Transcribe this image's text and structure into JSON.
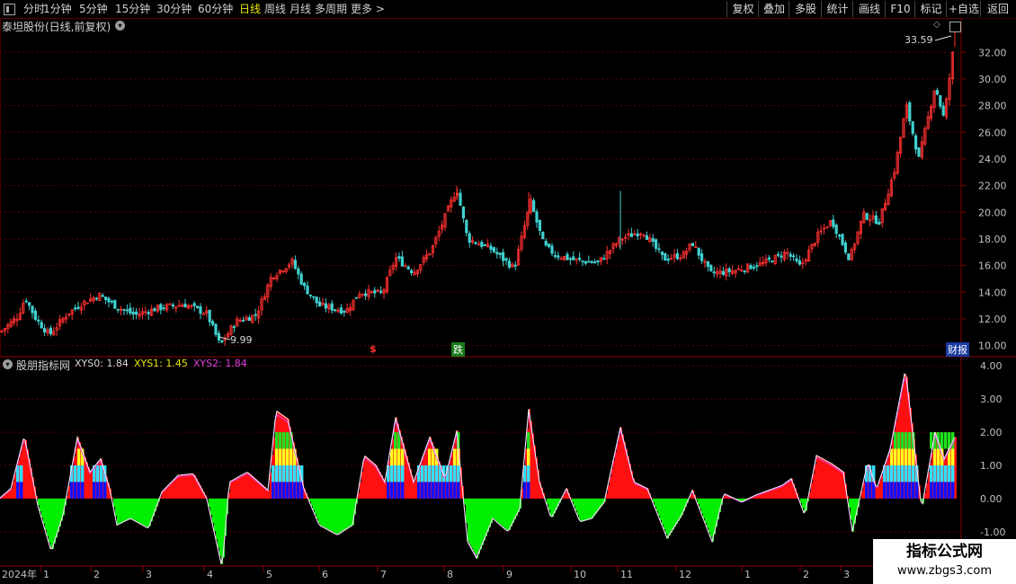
{
  "toolbar": {
    "periods": [
      "分时",
      "1分钟",
      "5分钟",
      "15分钟",
      "30分钟",
      "60分钟",
      "日线",
      "周线",
      "月线",
      "多周期",
      "更多 >"
    ],
    "active_period": "日线",
    "buttons": [
      "复权",
      "叠加",
      "多股",
      "统计",
      "画线",
      "F10",
      "标记",
      "+自选",
      "返回"
    ]
  },
  "main_chart": {
    "title": "泰坦股份(日线,前复权)",
    "high_label": "33.59",
    "low_label": "9.99",
    "event_markers": [
      "$",
      "跌",
      "财报"
    ],
    "y_ticks": [
      "32.00",
      "30.00",
      "28.00",
      "26.00",
      "24.00",
      "22.00",
      "20.00",
      "18.00",
      "16.00",
      "14.00",
      "12.00",
      "10.00"
    ]
  },
  "indicator": {
    "name": "股朋指标网",
    "labels": [
      {
        "name": "XYS0",
        "value": "1.84",
        "color": "#d8d8d8"
      },
      {
        "name": "XYS1",
        "value": "1.45",
        "color": "#e8e800"
      },
      {
        "name": "XYS2",
        "value": "1.84",
        "color": "#e040e0"
      }
    ],
    "y_ticks": [
      "4.00",
      "3.00",
      "2.00",
      "1.00",
      "0.00",
      "-1.00"
    ]
  },
  "time_axis": {
    "year_label": "2024年",
    "months": [
      "1",
      "2",
      "3",
      "4",
      "5",
      "6",
      "7",
      "8",
      "9",
      "10",
      "11",
      "12",
      "1",
      "2",
      "3"
    ]
  },
  "watermark": {
    "line1": "指标公式网",
    "line2": "www.zbgs3.com"
  },
  "colors": {
    "up": "#ff3030",
    "down": "#40d0d0",
    "grid": "#5a0000",
    "frame": "#8a0000",
    "axis_text": "#c0c0c0"
  },
  "chart_data": {
    "type": "candlestick",
    "price_path": [
      [
        0,
        11.0
      ],
      [
        20,
        12.2
      ],
      [
        28,
        13.6
      ],
      [
        40,
        12.0
      ],
      [
        55,
        10.8
      ],
      [
        75,
        12.4
      ],
      [
        92,
        13.2
      ],
      [
        110,
        13.8
      ],
      [
        130,
        12.9
      ],
      [
        150,
        12.3
      ],
      [
        175,
        12.8
      ],
      [
        205,
        13.1
      ],
      [
        230,
        12.4
      ],
      [
        245,
        10.0
      ],
      [
        262,
        11.8
      ],
      [
        285,
        12.3
      ],
      [
        302,
        15.2
      ],
      [
        325,
        16.3
      ],
      [
        338,
        14.4
      ],
      [
        355,
        13.0
      ],
      [
        385,
        12.6
      ],
      [
        400,
        14.0
      ],
      [
        425,
        13.9
      ],
      [
        440,
        16.6
      ],
      [
        460,
        15.5
      ],
      [
        480,
        17.2
      ],
      [
        508,
        21.8
      ],
      [
        520,
        18.0
      ],
      [
        545,
        17.3
      ],
      [
        572,
        15.8
      ],
      [
        590,
        20.8
      ],
      [
        605,
        17.5
      ],
      [
        618,
        16.8
      ],
      [
        640,
        16.4
      ],
      [
        665,
        16.2
      ],
      [
        690,
        18.0
      ],
      [
        715,
        18.6
      ],
      [
        738,
        16.5
      ],
      [
        760,
        16.8
      ],
      [
        770,
        17.7
      ],
      [
        790,
        15.4
      ],
      [
        815,
        15.6
      ],
      [
        850,
        16.2
      ],
      [
        875,
        17.0
      ],
      [
        890,
        15.9
      ],
      [
        910,
        18.3
      ],
      [
        925,
        19.4
      ],
      [
        945,
        16.5
      ],
      [
        960,
        19.8
      ],
      [
        978,
        19.3
      ],
      [
        995,
        23.2
      ],
      [
        1008,
        28.0
      ],
      [
        1022,
        24.0
      ],
      [
        1040,
        29.5
      ],
      [
        1050,
        27.0
      ],
      [
        1062,
        33.2
      ]
    ],
    "ylim": [
      9.5,
      33.5
    ],
    "indicator": {
      "series": [
        {
          "name": "XYS0",
          "path": [
            [
              0,
              0.02
            ],
            [
              12,
              0.3
            ],
            [
              27,
              1.9
            ],
            [
              42,
              -0.2
            ],
            [
              57,
              -1.6
            ],
            [
              70,
              -0.5
            ],
            [
              86,
              1.85
            ],
            [
              100,
              0.8
            ],
            [
              112,
              1.2
            ],
            [
              122,
              0.3
            ],
            [
              130,
              -0.8
            ],
            [
              145,
              -0.6
            ],
            [
              165,
              -0.9
            ],
            [
              180,
              0.2
            ],
            [
              198,
              0.7
            ],
            [
              215,
              0.75
            ],
            [
              230,
              0.0
            ],
            [
              247,
              -2.1
            ],
            [
              255,
              0.5
            ],
            [
              275,
              0.8
            ],
            [
              298,
              0.25
            ],
            [
              307,
              2.65
            ],
            [
              320,
              2.4
            ],
            [
              338,
              0.3
            ],
            [
              355,
              -0.8
            ],
            [
              375,
              -1.1
            ],
            [
              392,
              -0.8
            ],
            [
              405,
              1.3
            ],
            [
              418,
              1.0
            ],
            [
              428,
              0.5
            ],
            [
              440,
              2.45
            ],
            [
              460,
              0.5
            ],
            [
              478,
              1.85
            ],
            [
              495,
              0.6
            ],
            [
              508,
              2.05
            ],
            [
              520,
              -1.3
            ],
            [
              530,
              -1.8
            ],
            [
              548,
              -0.6
            ],
            [
              565,
              -1.0
            ],
            [
              578,
              -0.3
            ],
            [
              588,
              2.7
            ],
            [
              600,
              0.5
            ],
            [
              613,
              -0.6
            ],
            [
              630,
              0.3
            ],
            [
              645,
              -0.7
            ],
            [
              658,
              -0.6
            ],
            [
              672,
              -0.1
            ],
            [
              690,
              2.15
            ],
            [
              705,
              0.5
            ],
            [
              720,
              0.3
            ],
            [
              742,
              -1.2
            ],
            [
              758,
              -0.5
            ],
            [
              770,
              0.25
            ],
            [
              792,
              -1.3
            ],
            [
              805,
              0.15
            ],
            [
              825,
              -0.1
            ],
            [
              840,
              0.1
            ],
            [
              870,
              0.4
            ],
            [
              880,
              0.6
            ],
            [
              895,
              -0.5
            ],
            [
              908,
              1.3
            ],
            [
              925,
              1.05
            ],
            [
              938,
              0.8
            ],
            [
              948,
              -1.0
            ],
            [
              965,
              1.1
            ],
            [
              975,
              0.3
            ],
            [
              990,
              1.5
            ],
            [
              1007,
              3.9
            ],
            [
              1025,
              -0.3
            ],
            [
              1040,
              2.0
            ],
            [
              1050,
              1.2
            ],
            [
              1062,
              1.85
            ]
          ],
          "color": "#ff3030"
        },
        {
          "name": "XYS1",
          "color": "#e8e800"
        },
        {
          "name": "XYS2",
          "color": "#e040e0"
        }
      ],
      "ylim": [
        -1.9,
        4.25
      ]
    }
  }
}
